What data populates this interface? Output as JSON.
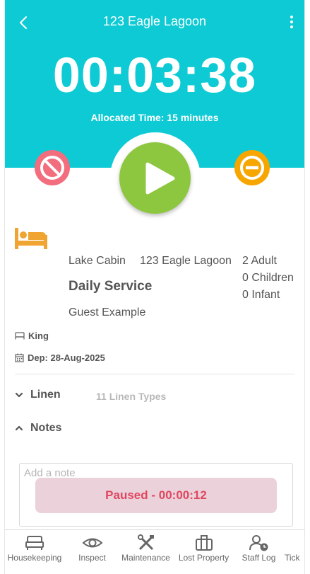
{
  "header": {
    "title": "123 Eagle Lagoon",
    "back_icon": "chevron-left-icon",
    "menu_icon": "more-vertical-icon"
  },
  "timer": {
    "elapsed": "00:03:38",
    "allocated": "Allocated Time: 15 minutes"
  },
  "controls": {
    "stop_icon": "block-icon",
    "play_icon": "play-icon",
    "pause_icon": "minus-circle-icon"
  },
  "booking": {
    "room_type": "Lake Cabin",
    "room_name": "123 Eagle Lagoon",
    "service": "Daily Service",
    "guest": "Guest Example",
    "adults": "2 Adult",
    "children": "0 Children",
    "infants": "0 Infant",
    "bed": "King",
    "departure": "Dep: 28-Aug-2025"
  },
  "sections": {
    "linen_label": "Linen",
    "linen_summary": "11 Linen Types",
    "notes_label": "Notes",
    "note_placeholder": "Add a note"
  },
  "status": {
    "paused": "Paused - 00:00:12"
  },
  "nav": {
    "items": [
      {
        "label": "Housekeeping",
        "icon": "bed-icon"
      },
      {
        "label": "Inspect",
        "icon": "eye-icon"
      },
      {
        "label": "Maintenance",
        "icon": "tools-icon"
      },
      {
        "label": "Lost Property",
        "icon": "briefcase-icon"
      },
      {
        "label": "Staff Log",
        "icon": "user-clock-icon"
      },
      {
        "label": "Tick",
        "icon": ""
      }
    ]
  },
  "colors": {
    "hero": "#0ecad4",
    "play": "#8dc63f",
    "stop": "#f26d7d",
    "pause": "#f7a600",
    "bed_icon": "#f0a431",
    "paused_text": "#e0475f",
    "paused_bg": "#ead1da"
  }
}
